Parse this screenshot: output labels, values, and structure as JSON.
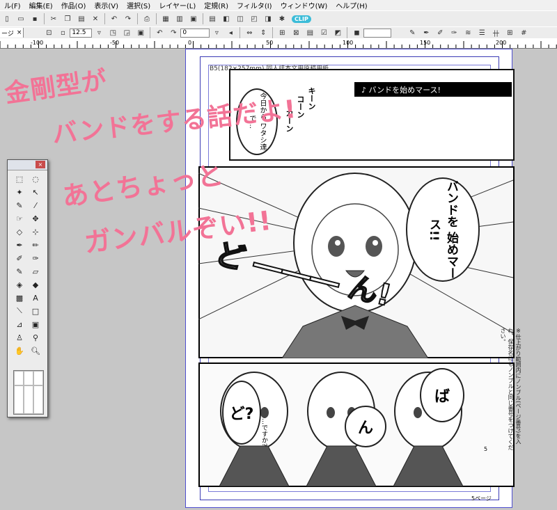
{
  "menubar": {
    "items": [
      "ル(F)",
      "編集(E)",
      "作品(O)",
      "表示(V)",
      "選択(S)",
      "レイヤー(L)",
      "定規(R)",
      "フィルタ(I)",
      "ウィンドウ(W)",
      "ヘルプ(H)"
    ]
  },
  "toolbar": {
    "clip_label": "CLIP",
    "doc_tab": "ージ",
    "doc_tab_close": "×",
    "brush_size": "12.5",
    "angle": "0"
  },
  "ruler": {
    "ticks": [
      "-100",
      "-50",
      "0",
      "50",
      "100",
      "150",
      "200"
    ]
  },
  "page": {
    "paper_header": "B5(182×257mm) 同人誌本文用原稿用紙",
    "banner": "♪ バンドを始めマース!",
    "page_number": "5",
    "page_label": "5ページ",
    "side_note": "※仕上がり範囲内にノンブル(ページ番号)を入れ、保存名にもノンブルと同じ番号をつけてください。"
  },
  "manga": {
    "bubble_today": "今日から ワタシ達で…",
    "sfx_kin": "キーン",
    "sfx_kon": "コーン",
    "sfx_kan": "カーン",
    "bubble_band": "バンドを 始めマース!!",
    "sfx_doon": "ど ――― ん!",
    "bubble_do": "ど?",
    "bubble_desuka": "…ですか?",
    "bubble_n": "ん",
    "bubble_ba": "ば"
  },
  "annotations": {
    "line1": "金剛型が",
    "line2": "バンドをする話だよ!",
    "line3": "あとちょっと",
    "line4": "ガンバルぞい!!"
  },
  "toolpanel": {
    "close": "×"
  },
  "colors": {
    "accent_pink": "#f27396",
    "page_border": "#4d4dd0",
    "clip_badge": "#3bbcd8"
  }
}
